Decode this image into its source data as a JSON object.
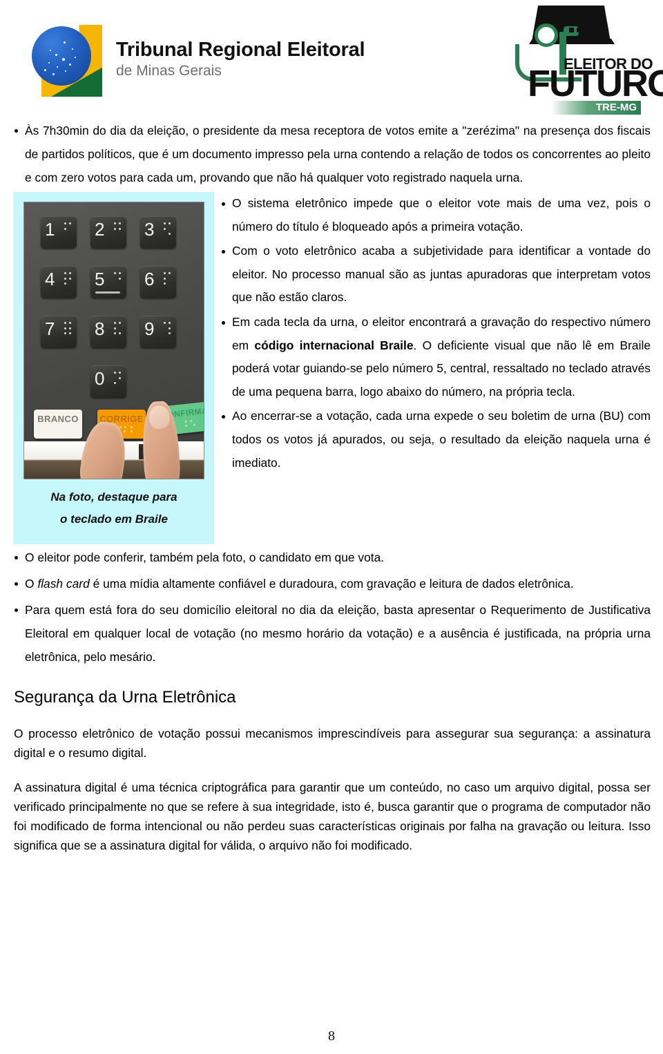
{
  "header": {
    "tre_logo": {
      "line1": "Tribunal Regional Eleitoral",
      "line2": "de Minas Gerais",
      "emblem_name": "brasil-emblem",
      "colors": {
        "blue": "#2160bf",
        "yellow": "#f5b608",
        "green": "#156d36"
      }
    },
    "futuro_logo": {
      "line1": "ELEITOR DO",
      "line2": "FUTURO",
      "badge": "TRE-MG",
      "colors": {
        "green": "#2b7d52",
        "black": "#111111"
      }
    }
  },
  "top_bullets": [
    "Às 7h30min do dia da eleição, o presidente da mesa receptora de votos emite a \"zerézima\" na presença dos fiscais de partidos políticos, que é um documento impresso pela urna contendo a relação de todos os concorrentes ao pleito e com zero votos para cada um, provando que não há qualquer voto registrado naquela urna."
  ],
  "figure": {
    "caption_line1": "Na foto, destaque para",
    "caption_line2": "o teclado em Braile",
    "background_color": "#c6f7fb",
    "keypad": {
      "number_keys": [
        "1",
        "2",
        "3",
        "4",
        "5",
        "6",
        "7",
        "8",
        "9",
        "0"
      ],
      "function_keys": [
        "BRANCO",
        "CORRIGE",
        "CONFIRMA"
      ],
      "function_key_colors": {
        "BRANCO": "#f6f3ec",
        "CORRIGE": "#f59b00",
        "CONFIRMA": "#63c98a"
      },
      "highlighted_key": "5"
    }
  },
  "right_bullets": [
    {
      "parts": [
        {
          "text": "O sistema eletrônico impede que o eleitor vote mais de uma vez, pois o número do título é bloqueado após a primeira votação.",
          "style": "normal"
        }
      ]
    },
    {
      "parts": [
        {
          "text": "Com o voto eletrônico acaba a subjetividade para identificar a vontade do eleitor. No processo manual são as juntas apuradoras que interpretam votos que não estão claros.",
          "style": "normal"
        }
      ]
    },
    {
      "parts": [
        {
          "text": "Em cada tecla da urna, o eleitor encontrará a gravação do respectivo número em ",
          "style": "normal"
        },
        {
          "text": "código internacional Braile",
          "style": "bold"
        },
        {
          "text": ". O deficiente visual que não lê em Braile poderá votar guiando-se pelo número 5, central, ressaltado no teclado através de uma pequena barra, logo abaixo do número, na própria tecla.",
          "style": "normal"
        }
      ]
    },
    {
      "parts": [
        {
          "text": "Ao encerrar-se a votação, cada urna expede o seu boletim de urna (BU) com todos os votos já apurados, ou seja, o resultado da eleição naquela urna é imediato.",
          "style": "normal"
        }
      ]
    }
  ],
  "below_bullets": [
    {
      "parts": [
        {
          "text": "O eleitor pode conferir, também pela foto, o candidato em que vota.",
          "style": "normal"
        }
      ]
    },
    {
      "parts": [
        {
          "text": "O ",
          "style": "normal"
        },
        {
          "text": "flash card",
          "style": "italic"
        },
        {
          "text": " é uma mídia altamente confiável e duradoura, com gravação e leitura de dados eletrônica.",
          "style": "normal"
        }
      ]
    },
    {
      "parts": [
        {
          "text": "Para quem está fora do seu domicílio eleitoral no dia da eleição, basta apresentar o Requerimento de Justificativa Eleitoral em qualquer local de votação (no mesmo horário da votação) e a ausência é justificada, na própria urna eletrônica, pelo mesário.",
          "style": "normal"
        }
      ]
    }
  ],
  "section": {
    "heading": "Segurança da Urna Eletrônica",
    "paragraphs": [
      "O processo eletrônico de votação possui mecanismos imprescindíveis para assegurar sua segurança: a assinatura digital e o resumo digital.",
      "A assinatura digital é uma técnica criptográfica para garantir que um conteúdo, no caso um arquivo digital, possa ser verificado principalmente no que se refere à sua integridade, isto é, busca garantir que o programa de computador não foi modificado de forma intencional ou não perdeu suas características originais por falha na gravação ou leitura. Isso significa que se a assinatura digital for válida, o arquivo não foi modificado."
    ]
  },
  "footer": {
    "page_number": "8"
  }
}
